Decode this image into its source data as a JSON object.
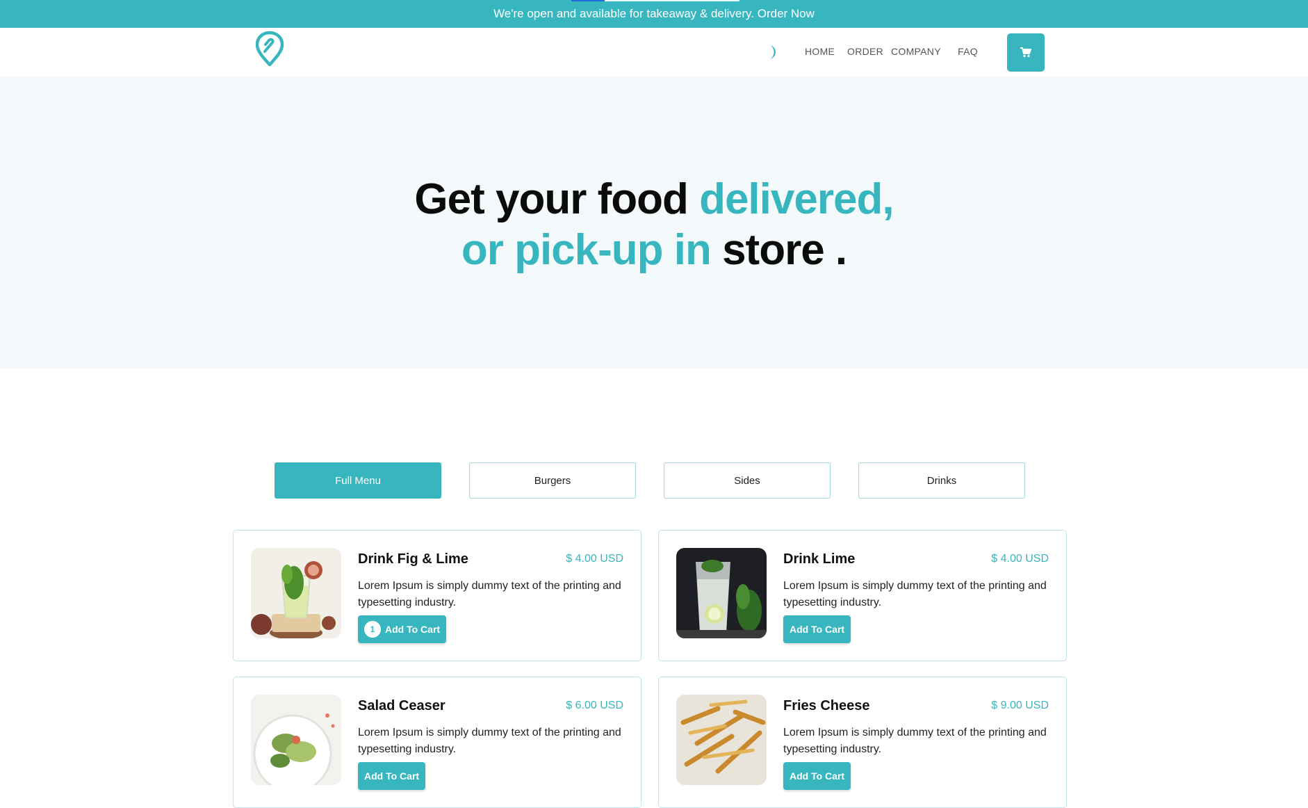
{
  "banner": {
    "text": "We're open and available for takeaway & delivery. Order Now"
  },
  "nav": {
    "logo_icon": "map-pin-logo-icon",
    "theme_icon": "moon-icon",
    "links": [
      "HOME",
      "ORDER",
      "COMPANY",
      "FAQ"
    ],
    "cart_icon": "shopping-cart-icon"
  },
  "hero": {
    "line1_dark": "Get your food ",
    "line1_accent": "delivered,",
    "line2_accent": "or pick-up in ",
    "line2_dark": "store ."
  },
  "tabs": [
    {
      "label": "Full Menu",
      "active": true
    },
    {
      "label": "Burgers",
      "active": false
    },
    {
      "label": "Sides",
      "active": false
    },
    {
      "label": "Drinks",
      "active": false
    }
  ],
  "products": [
    {
      "title": "Drink Fig & Lime",
      "price": "$ 4.00 USD",
      "description": "Lorem Ipsum is simply dummy text of the printing and typesetting industry.",
      "button": "Add To Cart",
      "cart_qty": "1",
      "image": "drink-fig-lime-photo"
    },
    {
      "title": "Drink Lime",
      "price": "$ 4.00 USD",
      "description": "Lorem Ipsum is simply dummy text of the printing and typesetting industry.",
      "button": "Add To Cart",
      "image": "drink-lime-photo"
    },
    {
      "title": "Salad Ceaser",
      "price": "$ 6.00 USD",
      "description": "Lorem Ipsum is simply dummy text of the printing and typesetting industry.",
      "button": "Add To Cart",
      "image": "salad-ceaser-photo"
    },
    {
      "title": "Fries Cheese",
      "price": "$ 9.00 USD",
      "description": "Lorem Ipsum is simply dummy text of the printing and typesetting industry.",
      "button": "Add To Cart",
      "image": "fries-cheese-photo"
    }
  ],
  "colors": {
    "accent": "#37b6bf",
    "hero_bg": "#f4fafb",
    "text_dark": "#0b0b0b"
  }
}
